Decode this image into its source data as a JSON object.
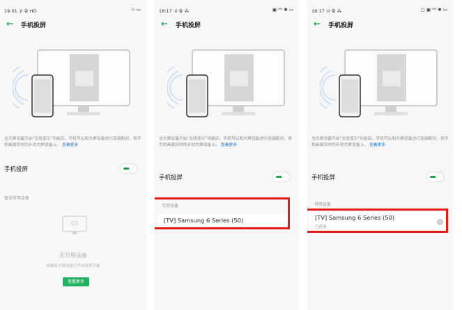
{
  "accent_color": "#1ca34a",
  "link_color": "#1d74c9",
  "highlight_color": "#e31b1b",
  "screen1": {
    "status_time": "19:01",
    "status_left_icons": "⫶ıl 令 HD",
    "status_right_icons": "☉ ▭",
    "title": "手机投屏",
    "desc_text": "当大屏设备开启\"无线显示\"功能后，手机可以和大屏设备进行连接配对，将手机画面实时同步到大屏设备上。",
    "desc_link": "查看更多",
    "toggle_label": "手机投屏",
    "toggle_on": true,
    "section_label": "暂无可用设备",
    "empty_title": "无可用设备",
    "empty_subtitle": "请确保大屏设备已开启投屏功能",
    "more_button": "查看更多"
  },
  "screen2": {
    "status_time": "18:17",
    "status_left_icons": "⫶ıl 令 ⁂",
    "status_right_icons": "▣ ᴴᴰ ✱ ▭",
    "title": "手机投屏",
    "desc_text": "当大屏设备开启\"无线显示\"功能后，手机可以和大屏设备进行连接配对，将手机画面实时同步到大屏设备上。",
    "desc_link": "查看更多",
    "toggle_label": "手机投屏",
    "toggle_on": true,
    "section_label": "可用设备",
    "device_name": "[TV] Samsung 6 Series (50)"
  },
  "screen3": {
    "status_time": "18:17",
    "status_left_icons": "⫶ıl 令 ⁂",
    "status_right_icons": "▢ ▣ ᴴᴰ ✱ ▭",
    "title": "手机投屏",
    "desc_text": "当大屏设备开启\"无线显示\"功能后，手机可以和大屏设备进行连接配对，将手机画面实时同步到大屏设备上。",
    "desc_link": "查看更多",
    "toggle_label": "手机投屏",
    "toggle_on": true,
    "section_label": "可用设备",
    "device_name": "[TV] Samsung 6 Series (50)",
    "device_status": "已连接"
  }
}
